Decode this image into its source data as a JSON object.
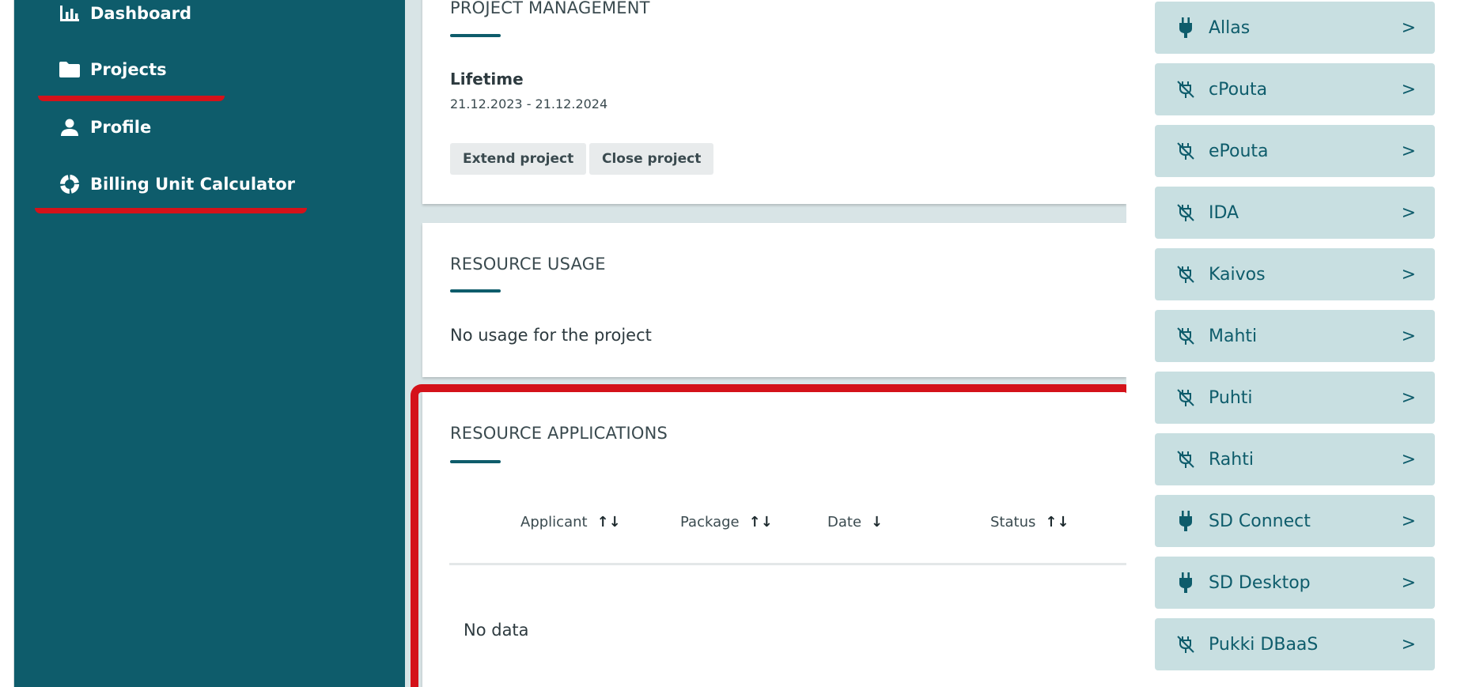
{
  "sidebar": {
    "items": [
      {
        "label": "Dashboard",
        "icon": "bar-chart-icon"
      },
      {
        "label": "Projects",
        "icon": "folder-icon"
      },
      {
        "label": "Profile",
        "icon": "person-icon"
      },
      {
        "label": "Billing Unit Calculator",
        "icon": "donut-icon"
      }
    ]
  },
  "project_management": {
    "title": "PROJECT MANAGEMENT",
    "lifetime_label": "Lifetime",
    "lifetime_value": "21.12.2023 - 21.12.2024",
    "extend_label": "Extend project",
    "close_label": "Close project"
  },
  "resource_usage": {
    "title": "RESOURCE USAGE",
    "message": "No usage for the project"
  },
  "resource_applications": {
    "title": "RESOURCE APPLICATIONS",
    "columns": [
      {
        "label": "Applicant",
        "sort": "↑↓"
      },
      {
        "label": "Package",
        "sort": "↑↓"
      },
      {
        "label": "Date",
        "sort": "↓"
      },
      {
        "label": "Status",
        "sort": "↑↓"
      }
    ],
    "empty_message": "No data"
  },
  "services": [
    {
      "label": "Allas",
      "icon": "plug-icon",
      "enabled": true
    },
    {
      "label": "cPouta",
      "icon": "plug-off-icon",
      "enabled": false
    },
    {
      "label": "ePouta",
      "icon": "plug-off-icon",
      "enabled": false
    },
    {
      "label": "IDA",
      "icon": "plug-off-icon",
      "enabled": false
    },
    {
      "label": "Kaivos",
      "icon": "plug-off-icon",
      "enabled": false
    },
    {
      "label": "Mahti",
      "icon": "plug-off-icon",
      "enabled": false
    },
    {
      "label": "Puhti",
      "icon": "plug-off-icon",
      "enabled": false
    },
    {
      "label": "Rahti",
      "icon": "plug-off-icon",
      "enabled": false
    },
    {
      "label": "SD Connect",
      "icon": "plug-icon",
      "enabled": true
    },
    {
      "label": "SD Desktop",
      "icon": "plug-icon",
      "enabled": true
    },
    {
      "label": "Pukki DBaaS",
      "icon": "plug-off-icon",
      "enabled": false
    }
  ],
  "colors": {
    "sidebar": "#0e5c6b",
    "accent": "#0e5c6b",
    "highlight": "#d4121a",
    "service_bg": "#c8dfe1"
  }
}
